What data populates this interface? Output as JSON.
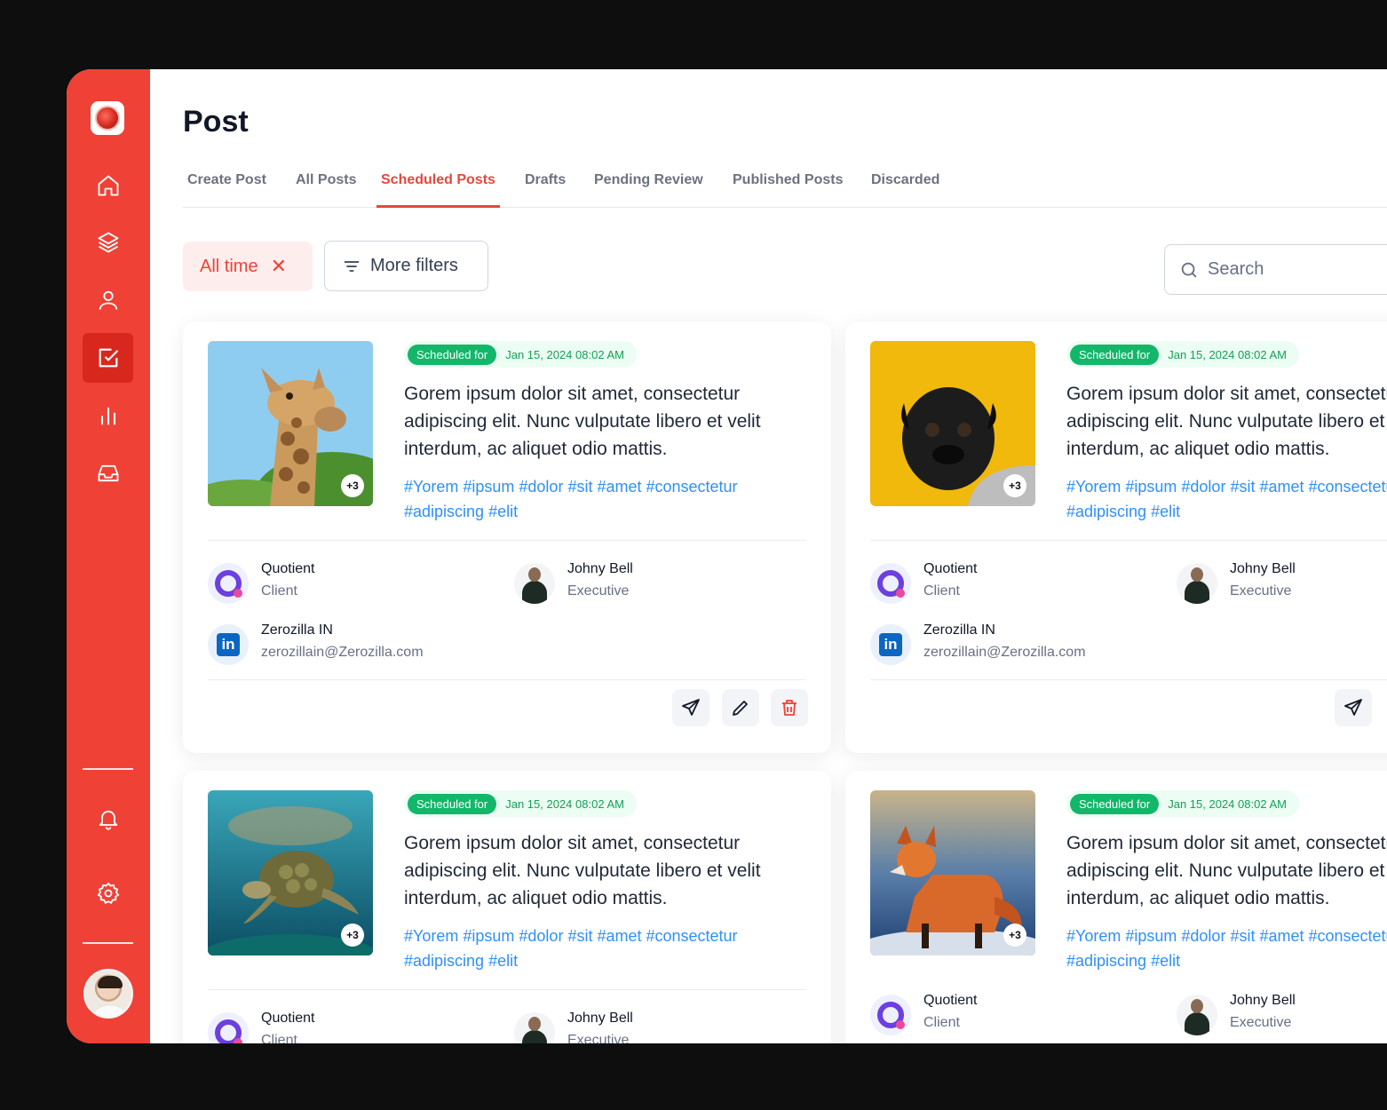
{
  "page": {
    "title": "Post"
  },
  "tabs": [
    {
      "label": "Create Post"
    },
    {
      "label": "All Posts"
    },
    {
      "label": "Scheduled Posts",
      "active": true
    },
    {
      "label": "Drafts"
    },
    {
      "label": "Pending Review"
    },
    {
      "label": "Published Posts"
    },
    {
      "label": "Discarded"
    }
  ],
  "filters": {
    "chip_label": "All time",
    "more_filters_label": "More filters"
  },
  "search": {
    "placeholder": "Search"
  },
  "sidebar": {
    "icons": [
      "home-icon",
      "layers-icon",
      "user-icon",
      "check-square-icon",
      "bar-chart-icon",
      "inbox-icon",
      "bell-icon",
      "gear-icon"
    ],
    "active": "check-square-icon"
  },
  "colors": {
    "brand": "#ef4136",
    "accent_text": "#e5483c",
    "scheduled_green": "#12b76a",
    "hashtag_blue": "#2e90fa"
  },
  "posts": [
    {
      "image": "giraffe",
      "more_count": "+3",
      "scheduled_label": "Scheduled for",
      "scheduled_date": "Jan 15, 2024 08:02 AM",
      "text": "Gorem ipsum dolor sit amet, consectetur adipiscing elit. Nunc vulputate libero et velit interdum, ac aliquet odio mattis.",
      "hashtags": "#Yorem #ipsum #dolor #sit #amet #consectetur #adipiscing #elit",
      "client": {
        "name": "Quotient",
        "role": "Client"
      },
      "executive": {
        "name": "Johny Bell",
        "role": "Executive"
      },
      "account": {
        "name": "Zerozilla IN",
        "email": "zerozillain@Zerozilla.com"
      }
    },
    {
      "image": "pug",
      "more_count": "+3",
      "scheduled_label": "Scheduled for",
      "scheduled_date": "Jan 15, 2024 08:02 AM",
      "text": "Gorem ipsum dolor sit amet, consectetur adipiscing elit. Nunc vulputate libero et velit interdum, ac aliquet odio mattis.",
      "hashtags": "#Yorem #ipsum #dolor #sit #amet #consectetur #adipiscing #elit",
      "client": {
        "name": "Quotient",
        "role": "Client"
      },
      "executive": {
        "name": "Johny Bell",
        "role": "Executive"
      },
      "account": {
        "name": "Zerozilla IN",
        "email": "zerozillain@Zerozilla.com"
      }
    },
    {
      "image": "turtle",
      "more_count": "+3",
      "scheduled_label": "Scheduled for",
      "scheduled_date": "Jan 15, 2024 08:02 AM",
      "text": "Gorem ipsum dolor sit amet, consectetur adipiscing elit. Nunc vulputate libero et velit interdum, ac aliquet odio mattis.",
      "hashtags": "#Yorem #ipsum #dolor #sit #amet #consectetur #adipiscing #elit",
      "client": {
        "name": "Quotient",
        "role": "Client"
      },
      "executive": {
        "name": "Johny Bell",
        "role": "Executive"
      }
    },
    {
      "image": "fox",
      "more_count": "+3",
      "scheduled_label": "Scheduled for",
      "scheduled_date": "Jan 15, 2024 08:02 AM",
      "text": "Gorem ipsum dolor sit amet, consectetur adipiscing elit. Nunc vulputate libero et velit interdum, ac aliquet odio mattis.",
      "hashtags": "#Yorem #ipsum #dolor #sit #amet #consectetur #adipiscing #elit",
      "client": {
        "name": "Quotient",
        "role": "Client"
      },
      "executive": {
        "name": "Johny Bell",
        "role": "Executive"
      }
    }
  ]
}
